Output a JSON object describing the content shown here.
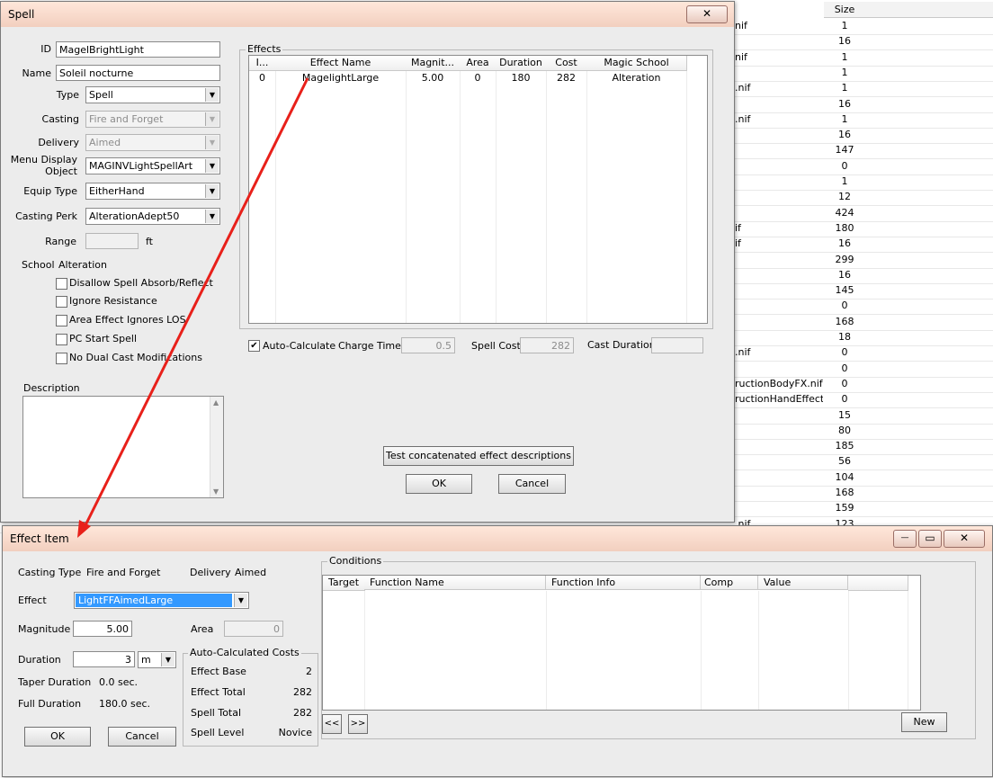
{
  "background": {
    "size_header": "Size",
    "rows": [
      {
        "model": "nif",
        "size": "1"
      },
      {
        "model": "",
        "size": "16"
      },
      {
        "model": "nif",
        "size": "1"
      },
      {
        "model": "",
        "size": "1"
      },
      {
        "model": ".nif",
        "size": "1"
      },
      {
        "model": "",
        "size": "16"
      },
      {
        "model": ".nif",
        "size": "1"
      },
      {
        "model": "",
        "size": "16"
      },
      {
        "model": "",
        "size": "147"
      },
      {
        "model": "",
        "size": "0"
      },
      {
        "model": "",
        "size": "1"
      },
      {
        "model": "",
        "size": "12"
      },
      {
        "model": "",
        "size": "424"
      },
      {
        "model": "if",
        "size": "180"
      },
      {
        "model": "if",
        "size": "16"
      },
      {
        "model": "",
        "size": "299"
      },
      {
        "model": "",
        "size": "16"
      },
      {
        "model": "",
        "size": "145"
      },
      {
        "model": "",
        "size": "0"
      },
      {
        "model": "",
        "size": "168"
      },
      {
        "model": "",
        "size": "18"
      },
      {
        "model": ".nif",
        "size": "0"
      },
      {
        "model": "",
        "size": "0"
      },
      {
        "model": "ructionBodyFX.nif",
        "size": "0"
      },
      {
        "model": "ructionHandEffect...",
        "size": "0"
      },
      {
        "model": "",
        "size": "15"
      },
      {
        "model": "",
        "size": "80"
      },
      {
        "model": "",
        "size": "185"
      },
      {
        "model": "",
        "size": "56"
      },
      {
        "model": "",
        "size": "104"
      },
      {
        "model": "",
        "size": "168"
      },
      {
        "model": "",
        "size": "159"
      },
      {
        "model": ".nif",
        "size": "123"
      }
    ]
  },
  "spell": {
    "title": "Spell",
    "close": "✕",
    "labels": {
      "id": "ID",
      "name": "Name",
      "type": "Type",
      "casting": "Casting",
      "delivery": "Delivery",
      "menu_display_1": "Menu Display",
      "menu_display_2": "Object",
      "equip_type": "Equip Type",
      "casting_perk": "Casting Perk",
      "range": "Range",
      "range_unit": "ft",
      "school": "School",
      "description": "Description"
    },
    "id": "MagelBrightLight",
    "name": "Soleil nocturne",
    "type": "Spell",
    "casting": "Fire and Forget",
    "delivery": "Aimed",
    "menu_display_object": "MAGINVLightSpellArt",
    "equip_type": "EitherHand",
    "casting_perk": "AlterationAdept50",
    "range": "",
    "school": "Alteration",
    "checkboxes": {
      "disallow_absorb": "Disallow Spell Absorb/Reflect",
      "ignore_resistance": "Ignore Resistance",
      "area_ignores_los": "Area Effect Ignores LOS",
      "pc_start": "PC Start Spell",
      "no_dual_cast": "No Dual Cast Modifications"
    },
    "effects": {
      "title": "Effects",
      "columns": [
        "I...",
        "Effect Name",
        "Magnit...",
        "Area",
        "Duration",
        "Cost",
        "Magic School"
      ],
      "rows": [
        {
          "index": "0",
          "name": "MagelightLarge",
          "magnitude": "5.00",
          "area": "0",
          "duration": "180",
          "cost": "282",
          "school": "Alteration"
        }
      ]
    },
    "auto_calculate": "Auto-Calculate",
    "auto_calculate_mark": "✔",
    "charge_time_label": "Charge Time",
    "charge_time": "0.5",
    "spell_cost_label": "Spell Cost",
    "spell_cost": "282",
    "cast_duration_label": "Cast Duration",
    "cast_duration": "",
    "test_button": "Test concatenated effect descriptions",
    "ok": "OK",
    "cancel": "Cancel"
  },
  "effect_item": {
    "title": "Effect Item",
    "min": "—",
    "max": "▭",
    "close": "✕",
    "casting_type_label": "Casting Type",
    "casting_type": "Fire and Forget",
    "delivery_label": "Delivery",
    "delivery": "Aimed",
    "effect_label": "Effect",
    "effect": "LightFFAimedLarge",
    "magnitude_label": "Magnitude",
    "magnitude": "5.00",
    "area_label": "Area",
    "area": "0",
    "duration_label": "Duration",
    "duration": "3",
    "duration_unit": "m",
    "taper_label": "Taper Duration",
    "taper": "0.0 sec.",
    "full_label": "Full Duration",
    "full": "180.0 sec.",
    "costs": {
      "title": "Auto-Calculated Costs",
      "effect_base_label": "Effect Base",
      "effect_base": "2",
      "effect_total_label": "Effect Total",
      "effect_total": "282",
      "spell_total_label": "Spell Total",
      "spell_total": "282",
      "spell_level_label": "Spell Level",
      "spell_level": "Novice"
    },
    "conditions": {
      "title": "Conditions",
      "columns": [
        "Target",
        "Function Name",
        "Function Info",
        "Comp",
        "Value",
        ""
      ],
      "prev": "<<",
      "next": ">>",
      "new": "New"
    },
    "ok": "OK",
    "cancel": "Cancel"
  },
  "colors": {
    "annotation_arrow": "#e8201a",
    "selection": "#3399ff"
  }
}
